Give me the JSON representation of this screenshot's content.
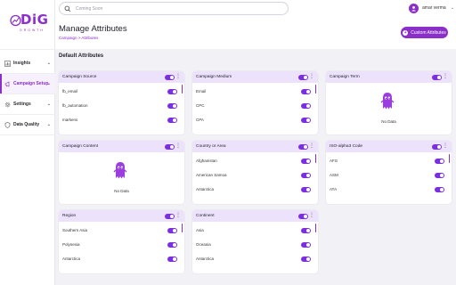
{
  "brand": {
    "name": "DiG",
    "tagline": "GROWTH",
    "color": "#8b2fc9"
  },
  "search": {
    "placeholder": "Coming Soon",
    "icon": "search-icon"
  },
  "user": {
    "name": "amar verma",
    "icon": "user-icon"
  },
  "sidebar": {
    "items": [
      {
        "label": "Insights",
        "icon": "bar-chart-icon",
        "active": false
      },
      {
        "label": "Campaign Setup",
        "icon": "campaign-icon",
        "active": true
      },
      {
        "label": "Settings",
        "icon": "gear-icon",
        "active": false
      },
      {
        "label": "Data Quality",
        "icon": "shield-icon",
        "active": false
      }
    ]
  },
  "header": {
    "title": "Manage Attributes",
    "breadcrumb": "Campaign > Attributes",
    "custom_button": "Custom Attributes"
  },
  "section": {
    "title": "Default Attributes"
  },
  "nodata_label": "No Data",
  "cards": [
    {
      "title": "Campaign Source",
      "enabled": true,
      "rows": [
        {
          "label": "fb_email",
          "on": true
        },
        {
          "label": "fb_automation",
          "on": true
        },
        {
          "label": "markens",
          "on": true
        }
      ],
      "scroll": true
    },
    {
      "title": "Campaign Medium",
      "enabled": true,
      "rows": [
        {
          "label": "Email",
          "on": true
        },
        {
          "label": "CPC",
          "on": true
        },
        {
          "label": "CPA",
          "on": true
        }
      ],
      "scroll": true
    },
    {
      "title": "Campaign Term",
      "enabled": true,
      "rows": [],
      "scroll": false
    },
    {
      "title": "Campaign Content",
      "enabled": true,
      "rows": [],
      "scroll": false
    },
    {
      "title": "Country or Area",
      "enabled": true,
      "rows": [
        {
          "label": "Afghanistan",
          "on": true
        },
        {
          "label": "American Samoa",
          "on": true
        },
        {
          "label": "Antarctica",
          "on": true
        }
      ],
      "scroll": true
    },
    {
      "title": "ISO-alpha3 Code",
      "enabled": true,
      "rows": [
        {
          "label": "AFG",
          "on": true
        },
        {
          "label": "ASM",
          "on": true
        },
        {
          "label": "ATA",
          "on": true
        }
      ],
      "scroll": true
    },
    {
      "title": "Region",
      "enabled": true,
      "rows": [
        {
          "label": "Southern Asia",
          "on": true
        },
        {
          "label": "Polynesia",
          "on": true
        },
        {
          "label": "Antarctica",
          "on": true
        }
      ],
      "scroll": true
    },
    {
      "title": "Continent",
      "enabled": true,
      "rows": [
        {
          "label": "Asia",
          "on": true
        },
        {
          "label": "Oceania",
          "on": true
        },
        {
          "label": "Antarctica",
          "on": true
        }
      ],
      "scroll": true
    }
  ]
}
